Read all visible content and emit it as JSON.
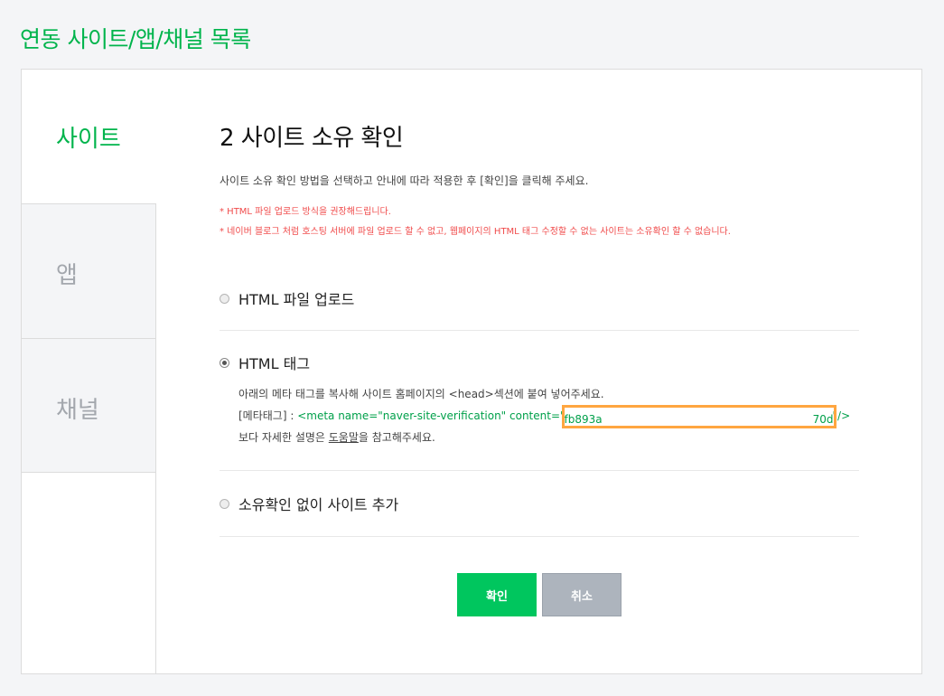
{
  "page_title": "연동 사이트/앱/채널 목록",
  "sidebar": {
    "tabs": [
      {
        "label": "사이트",
        "active": true
      },
      {
        "label": "앱",
        "active": false
      },
      {
        "label": "채널",
        "active": false
      }
    ]
  },
  "main": {
    "title": "2 사이트 소유 확인",
    "description": "사이트 소유 확인 방법을 선택하고 안내에 따라 적용한 후 [확인]을 클릭해 주세요.",
    "notes": [
      "* HTML 파일 업로드 방식을 권장해드립니다.",
      "* 네이버 블로그 처럼 호스팅 서버에 파일 업로드 할 수 없고, 웹페이지의 HTML 태그 수정할 수 없는 사이트는 소유확인 할 수 없습니다."
    ],
    "options": [
      {
        "label": "HTML 파일 업로드",
        "selected": false
      },
      {
        "label": "HTML 태그",
        "selected": true
      },
      {
        "label": "소유확인 없이 사이트 추가",
        "selected": false
      }
    ],
    "html_tag": {
      "instruction": "아래의 메타 태그를 복사해 사이트 홈페이지의 <head>섹션에 붙여 넣어주세요.",
      "meta_label": "[메타태그] : ",
      "meta_prefix": "<meta name=\"naver-site-verification\" content=\"",
      "meta_value_start": "fb893a",
      "meta_value_end": "70d",
      "meta_suffix": "\"/>",
      "help_prefix": "보다 자세한 설명은 ",
      "help_link": "도움말",
      "help_suffix": "을 참고해주세요."
    }
  },
  "buttons": {
    "ok": "확인",
    "cancel": "취소"
  },
  "colors": {
    "accent": "#00b44c",
    "ok_button": "#00c65e",
    "cancel_button": "#adb4bd",
    "note_text": "#f04b4b",
    "highlight_box": "#ffa640"
  }
}
